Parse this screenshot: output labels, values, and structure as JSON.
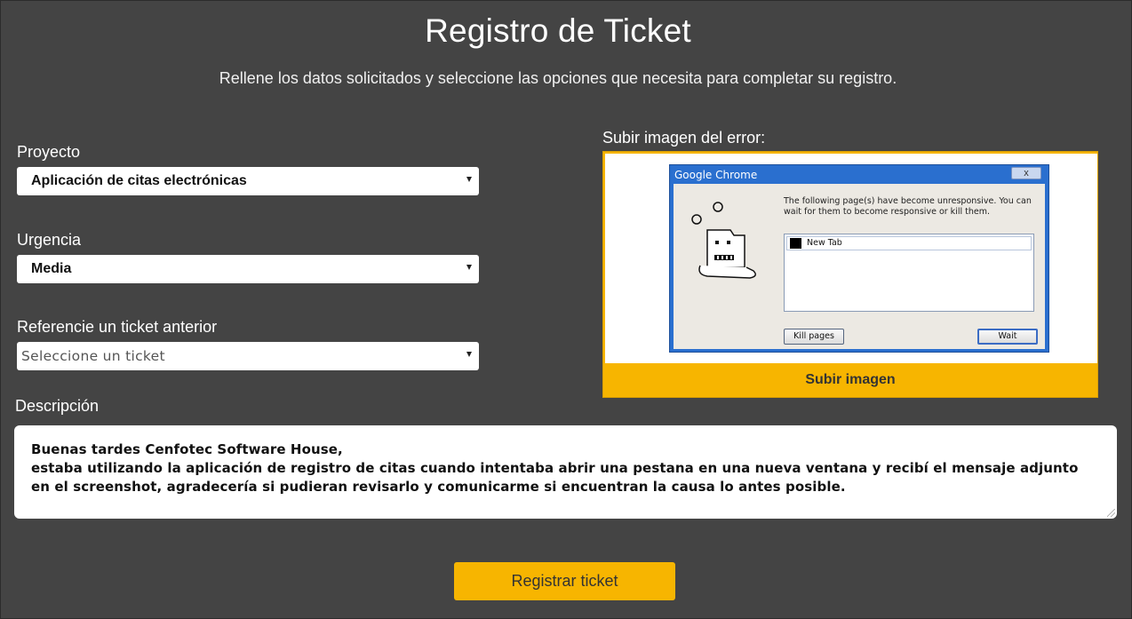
{
  "page": {
    "title": "Registro de Ticket",
    "subtitle": "Rellene los datos solicitados y seleccione las opciones que necesita para completar su registro."
  },
  "form": {
    "project": {
      "label": "Proyecto",
      "value": "Aplicación de citas electrónicas"
    },
    "urgency": {
      "label": "Urgencia",
      "value": "Media"
    },
    "reference": {
      "label": "Referencie un ticket anterior",
      "placeholder": "Seleccione un ticket"
    },
    "description": {
      "label": "Descripción",
      "line1": "Buenas tardes Cenfotec Software House,",
      "line2": "estaba utilizando la aplicación de registro de citas cuando intentaba abrir una pestana en una nueva ventana y recibí el mensaje adjunto en el screenshot, agradecería si pudieran revisarlo y comunicarme si encuentran la causa lo antes posible."
    },
    "upload": {
      "label": "Subir imagen del error:",
      "button": "Subir imagen"
    },
    "submit": "Registrar ticket"
  },
  "screenshot": {
    "window_title": "Google Chrome",
    "close_glyph": "x",
    "message": "The following page(s) have become unresponsive. You can wait for them to become responsive or kill them.",
    "list_item": "New Tab",
    "kill_button": "Kill pages",
    "wait_button": "Wait"
  },
  "colors": {
    "background": "#444444",
    "accent": "#f7b500",
    "text": "#ffffff"
  },
  "icons": {
    "dropdown": "caret-down-icon",
    "mascot": "sad-tab-mascot-icon"
  }
}
